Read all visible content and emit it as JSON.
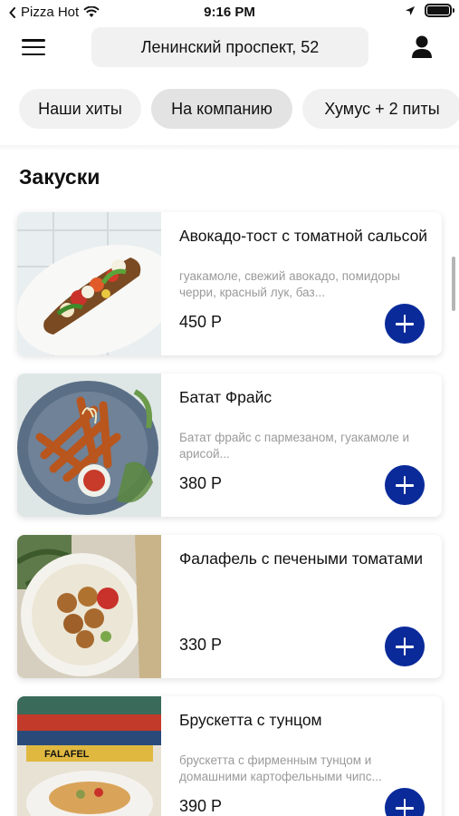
{
  "status_bar": {
    "carrier": "Pizza Hot",
    "time": "9:16 PM",
    "battery_level": 1.0
  },
  "header": {
    "address": "Ленинский проспект, 52"
  },
  "categories": [
    {
      "label": "Наши хиты",
      "active": false
    },
    {
      "label": "На компанию",
      "active": true
    },
    {
      "label": "Хумус + 2 питы",
      "active": false
    }
  ],
  "section": {
    "title": "Закуски"
  },
  "products": [
    {
      "name": "Авокадо-тост с томатной сальсой",
      "description": "гуакамоле, свежий авокадо, помидоры черри, красный лук, баз...",
      "price": "450 Р"
    },
    {
      "name": "Батат Фрайс",
      "description": "Батат фрайс с пармезаном, гуакамоле и арисой...",
      "price": "380 Р"
    },
    {
      "name": "Фалафель с печеными томатами",
      "description": "",
      "price": "330 Р"
    },
    {
      "name": "Брускетта с тунцом",
      "description": "брускетта с фирменным тунцом и домашними картофельными чипс...",
      "price": "390 Р"
    }
  ],
  "colors": {
    "accent": "#0a2a9a",
    "chip_bg": "#f1f1f1",
    "chip_active_bg": "#e3e3e3",
    "muted_text": "#9a9a9a"
  },
  "icons": {
    "menu": "hamburger-icon",
    "profile": "user-icon",
    "add": "plus-icon"
  }
}
